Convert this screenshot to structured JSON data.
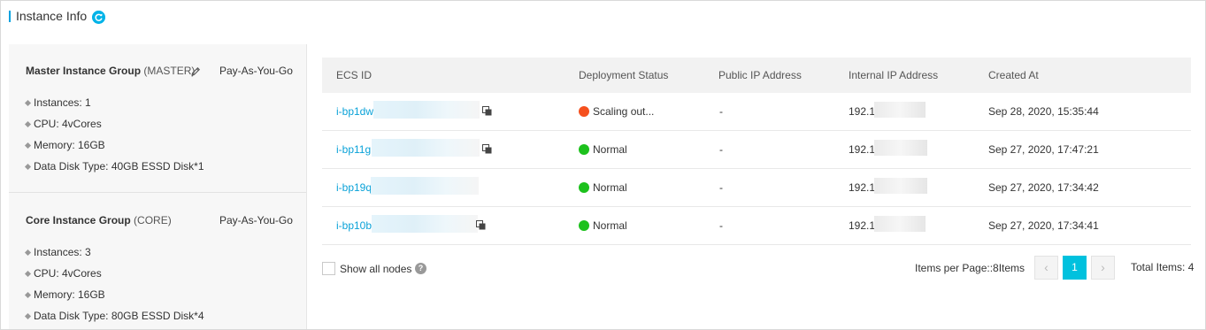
{
  "header": {
    "title": "Instance Info",
    "refresh_icon": "refresh-icon"
  },
  "groups": [
    {
      "name": "Master Instance Group",
      "role": "(MASTER)",
      "billing": "Pay-As-You-Go",
      "specs": [
        "Instances: 1",
        "CPU: 4vCores",
        "Memory: 16GB",
        "Data Disk Type: 40GB ESSD Disk*1"
      ]
    },
    {
      "name": "Core Instance Group",
      "role": "(CORE)",
      "billing": "Pay-As-You-Go",
      "specs": [
        "Instances: 3",
        "CPU: 4vCores",
        "Memory: 16GB",
        "Data Disk Type: 80GB ESSD Disk*4"
      ]
    }
  ],
  "table": {
    "columns": [
      "ECS ID",
      "Deployment Status",
      "Public IP Address",
      "Internal IP Address",
      "Created At"
    ],
    "rows": [
      {
        "ecs_id": "i-bp1dw",
        "status": "Scaling out...",
        "status_color": "#f5501e",
        "public_ip": "-",
        "internal_ip": "192.1",
        "created": "Sep 28, 2020, 15:35:44"
      },
      {
        "ecs_id": "i-bp11g",
        "status": "Normal",
        "status_color": "#1dc11d",
        "public_ip": "-",
        "internal_ip": "192.1",
        "created": "Sep 27, 2020, 17:47:21"
      },
      {
        "ecs_id": "i-bp19q",
        "status": "Normal",
        "status_color": "#1dc11d",
        "public_ip": "-",
        "internal_ip": "192.1",
        "created": "Sep 27, 2020, 17:34:42"
      },
      {
        "ecs_id": "i-bp10b",
        "status": "Normal",
        "status_color": "#1dc11d",
        "public_ip": "-",
        "internal_ip": "192.1",
        "created": "Sep 27, 2020, 17:34:41"
      }
    ]
  },
  "footer": {
    "show_all_nodes": "Show all nodes",
    "help": "?",
    "items_per_page": "Items per Page::8Items",
    "prev": "‹",
    "current_page": "1",
    "next": "›",
    "total": "Total Items: 4"
  },
  "colors": {
    "accent": "#00c1de",
    "link": "#0aa2d8",
    "scaling": "#f5501e",
    "normal": "#1dc11d"
  }
}
